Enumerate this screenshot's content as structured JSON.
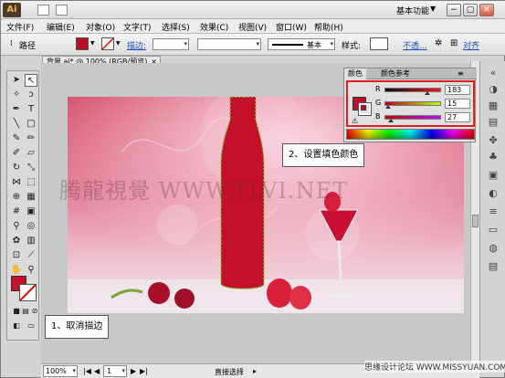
{
  "app": {
    "logo": "Ai",
    "workspace": "基本功能"
  },
  "window_buttons": {
    "minimize": "−",
    "restore": "▢",
    "close": "✕"
  },
  "menu": [
    "文件(F)",
    "编辑(E)",
    "对象(O)",
    "文字(T)",
    "选择(S)",
    "效果(C)",
    "视图(V)",
    "窗口(W)",
    "帮助(H)"
  ],
  "control": {
    "object_type": "路径",
    "stroke_label": "描边:",
    "stroke_profile": "基本",
    "style_label": "样式:",
    "opacity_label": "不透...",
    "align_label": "对齐"
  },
  "colors": {
    "fill": "#b7102a",
    "accent_red": "#e02020"
  },
  "document": {
    "tab_title": "背景.ai* @ 100% (RGB/预览)",
    "close": "×"
  },
  "color_panel": {
    "tabs": [
      "颜色",
      "颜色参考"
    ],
    "channels": [
      {
        "label": "R",
        "value": "183"
      },
      {
        "label": "G",
        "value": "15"
      },
      {
        "label": "B",
        "value": "27"
      }
    ]
  },
  "callouts": {
    "set_fill": "2、设置填色颜色",
    "no_stroke": "1、取消描边"
  },
  "watermark": "腾龍視覺 WWW.TLVI.NET",
  "status": {
    "zoom": "100%",
    "page": "1",
    "tool": "直接选择"
  },
  "site_mark": "思缘设计论坛 WWW.MISSYUAN.COM"
}
